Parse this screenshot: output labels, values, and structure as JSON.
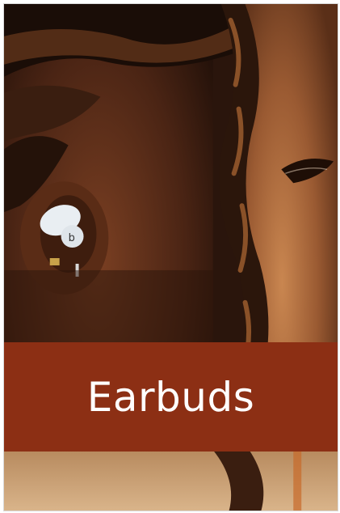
{
  "card": {
    "title": "Earbuds",
    "banner_color": "#8c2f14",
    "image_subject": "person-wearing-earbud"
  }
}
